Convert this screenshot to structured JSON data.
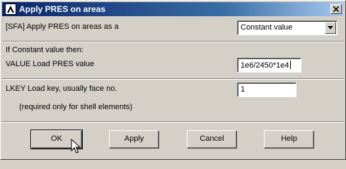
{
  "window": {
    "title": "Apply PRES on areas",
    "icon": "ansys-logo-icon",
    "close_icon": "close-icon"
  },
  "sfa": {
    "label": "[SFA] Apply PRES on areas as a",
    "selected": "Constant value"
  },
  "constant_header": "If Constant value then:",
  "value_field": {
    "label": "VALUE  Load PRES value",
    "value": "1e6/2450*1e4"
  },
  "lkey_field": {
    "label": "LKEY  Load key, usually face no.",
    "value": "1",
    "note": "(required only for shell elements)"
  },
  "buttons": {
    "ok": "OK",
    "apply": "Apply",
    "cancel": "Cancel",
    "help": "Help"
  },
  "colors": {
    "titlebar_start": "#0a246a",
    "titlebar_end": "#a6caf0",
    "dialog_bg": "#d4d0c8"
  }
}
